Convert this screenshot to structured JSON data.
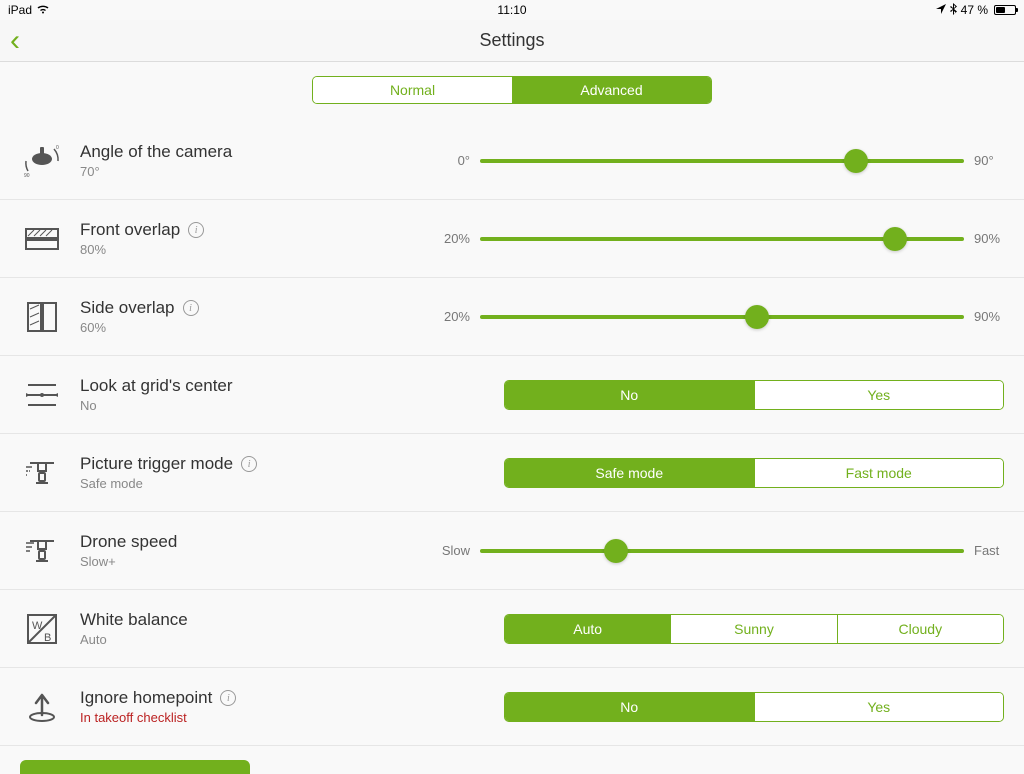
{
  "statusbar": {
    "device": "iPad",
    "time": "11:10",
    "battery_text": "47 %",
    "battery_pct": 47
  },
  "nav": {
    "title": "Settings",
    "back_glyph": "‹"
  },
  "mode_tabs": {
    "normal": "Normal",
    "advanced": "Advanced",
    "selected": "advanced"
  },
  "rows": {
    "camera_angle": {
      "title": "Angle of the camera",
      "value_label": "70°",
      "min_label": "0°",
      "max_label": "90°",
      "min": 0,
      "max": 90,
      "value": 70
    },
    "front_overlap": {
      "title": "Front overlap",
      "value_label": "80%",
      "min_label": "20%",
      "max_label": "90%",
      "min": 20,
      "max": 90,
      "value": 80
    },
    "side_overlap": {
      "title": "Side overlap",
      "value_label": "60%",
      "min_label": "20%",
      "max_label": "90%",
      "min": 20,
      "max": 90,
      "value": 60
    },
    "look_at_center": {
      "title": "Look at grid's center",
      "value_label": "No",
      "options": [
        "No",
        "Yes"
      ],
      "selected_index": 0
    },
    "picture_trigger": {
      "title": "Picture trigger mode",
      "value_label": "Safe mode",
      "options": [
        "Safe mode",
        "Fast mode"
      ],
      "selected_index": 0
    },
    "drone_speed": {
      "title": "Drone speed",
      "value_label": "Slow+",
      "min_label": "Slow",
      "max_label": "Fast",
      "min": 0,
      "max": 100,
      "value": 28
    },
    "white_balance": {
      "title": "White balance",
      "value_label": "Auto",
      "options": [
        "Auto",
        "Sunny",
        "Cloudy"
      ],
      "selected_index": 0
    },
    "ignore_homepoint": {
      "title": "Ignore homepoint",
      "value_label": "In takeoff checklist",
      "options": [
        "No",
        "Yes"
      ],
      "selected_index": 0
    }
  }
}
